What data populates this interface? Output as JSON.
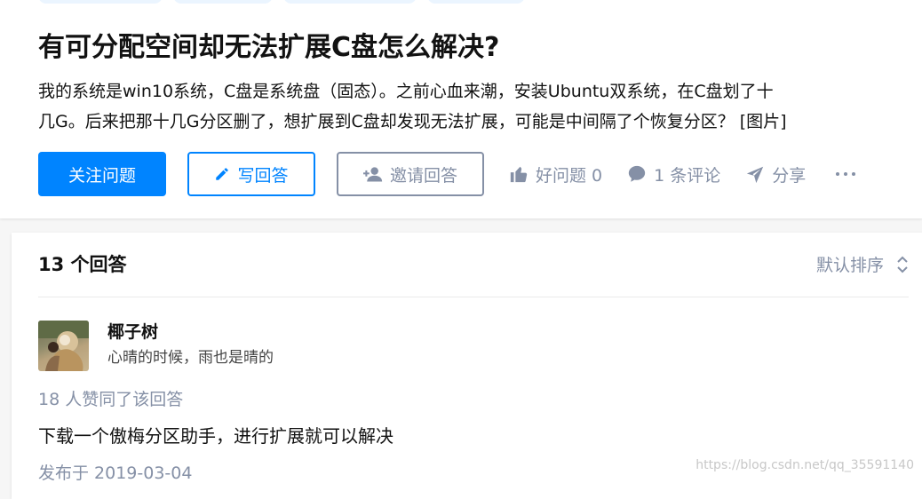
{
  "question": {
    "title": "有可分配空间却无法扩展C盘怎么解决?",
    "excerpt_line1": "我的系统是win10系统，C盘是系统盘（固态）。之前心血来潮，安装Ubuntu双系统，在C盘划了十",
    "excerpt_line2": "几G。后来把那十几G分区删了，想扩展到C盘却发现无法扩展，可能是中间隔了个恢复分区？ [图片]"
  },
  "actions": {
    "follow_label": "关注问题",
    "write_label": "写回答",
    "invite_label": "邀请回答",
    "good_question_label": "好问题 0",
    "comments_label": "1 条评论",
    "share_label": "分享"
  },
  "answers": {
    "count_label": "13 个回答",
    "sort_label": "默认排序"
  },
  "answer": {
    "author_name": "椰子树",
    "author_bio": "心晴的时候，雨也是晴的",
    "votes_label": "18 人赞同了该回答",
    "content": "下载一个傲梅分区助手，进行扩展就可以解决",
    "publish_time": "发布于 2019-03-04"
  },
  "watermark": "https://blog.csdn.net/qq_35591140",
  "colors": {
    "accent": "#0084ff",
    "muted": "#8590a6",
    "text": "#121212",
    "background": "#f6f6f6"
  },
  "icons": [
    "pencil-icon",
    "add-user-icon",
    "thumbs-up-icon",
    "comment-icon",
    "paper-plane-icon",
    "more-icon",
    "sort-icon"
  ]
}
